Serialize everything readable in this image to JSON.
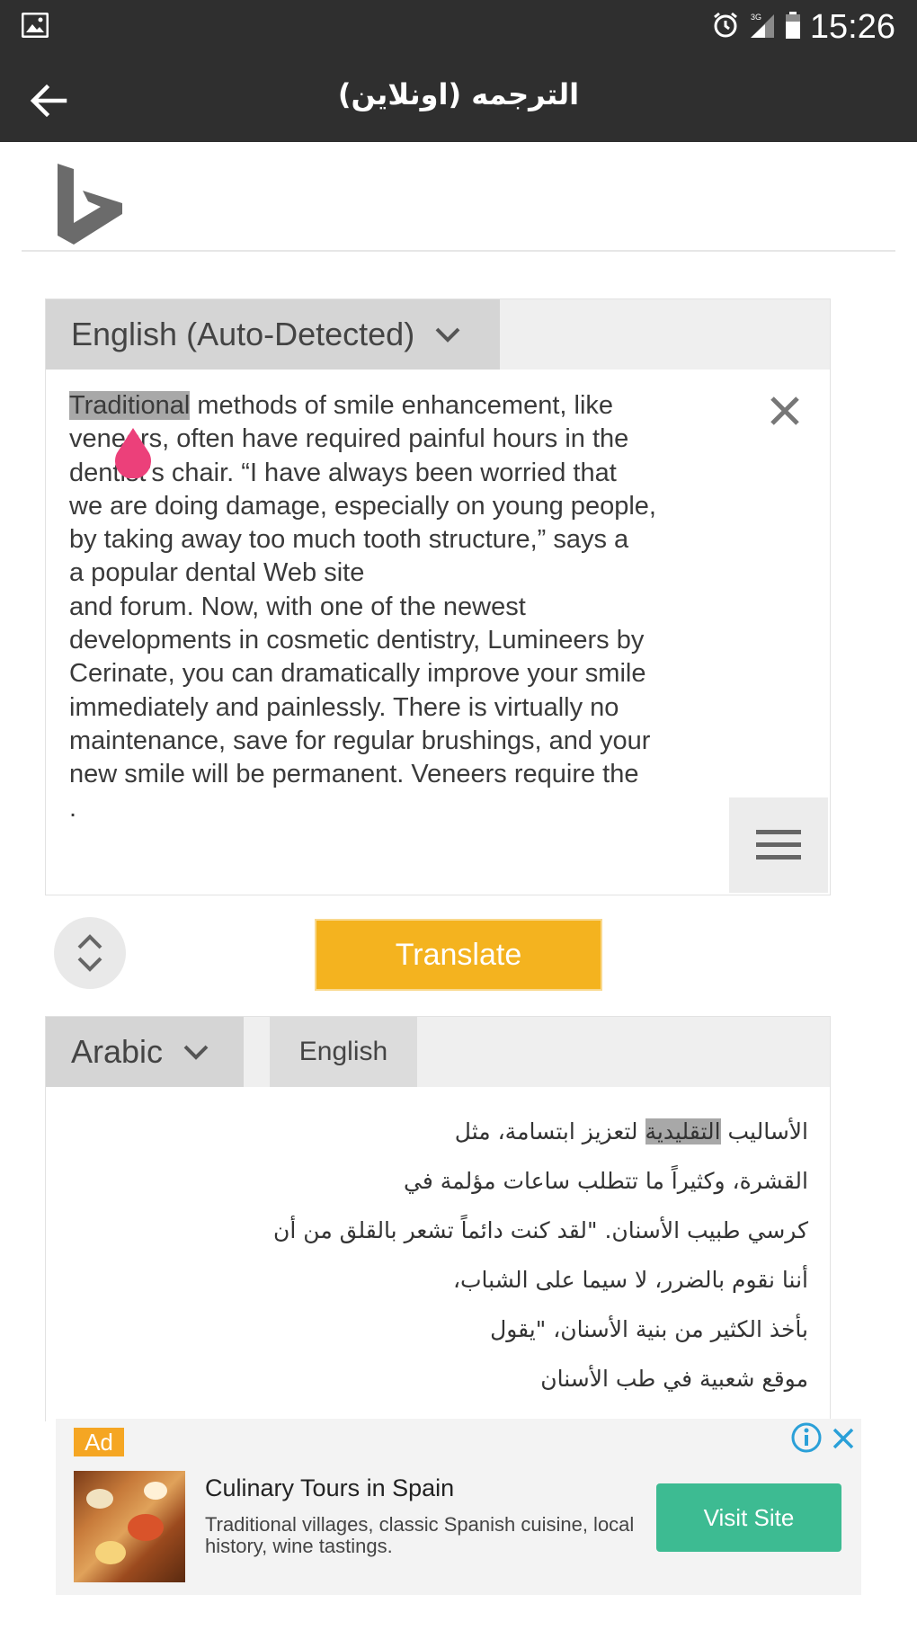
{
  "status_bar": {
    "time": "15:26",
    "network": "3G"
  },
  "app_bar": {
    "title": "الترجمه (اونلاين)"
  },
  "source": {
    "language": "English (Auto-Detected)",
    "highlighted_word": "Traditional",
    "text_rest": " methods of smile enhancement, like\nveneers, often have required painful hours in the\ndentist’s chair. “I have always been worried that\nwe are doing damage, especially on young people,\nby taking away too much tooth structure,” says a\n a popular dental Web site\nand forum. Now, with one of the newest\ndevelopments in cosmetic dentistry, Lumineers by\nCerinate, you can dramatically improve your smile\nimmediately and painlessly. There is virtually no\nmaintenance, save for regular brushings, and your\nnew smile will be permanent. Veneers require the\n."
  },
  "actions": {
    "translate_label": "Translate"
  },
  "target": {
    "language": "Arabic",
    "alt_language": "English",
    "line1_before": "الأساليب ",
    "highlighted_word": "التقليدية",
    "line1_after": " لتعزيز ابتسامة، مثل",
    "text_rest": "القشرة، وكثيراً ما تتطلب ساعات مؤلمة في\nكرسي طبيب الأسنان. \"لقد كنت دائماً تشعر بالقلق من أن\nأننا نقوم بالضرر، لا سيما على الشباب،\nبأخذ الكثير من بنية الأسنان، \"يقول\nموقع شعبية في طب الأسنان"
  },
  "ad": {
    "badge": "Ad",
    "title": "Culinary Tours in Spain",
    "description": "Traditional villages, classic Spanish cuisine, local history, wine tastings.",
    "cta": "Visit Site"
  },
  "colors": {
    "bar": "#2f2f2f",
    "translate_button": "#f4b31f",
    "visit_button": "#3dbb92",
    "ad_badge": "#f5a623",
    "caret_handle": "#ec407a"
  }
}
